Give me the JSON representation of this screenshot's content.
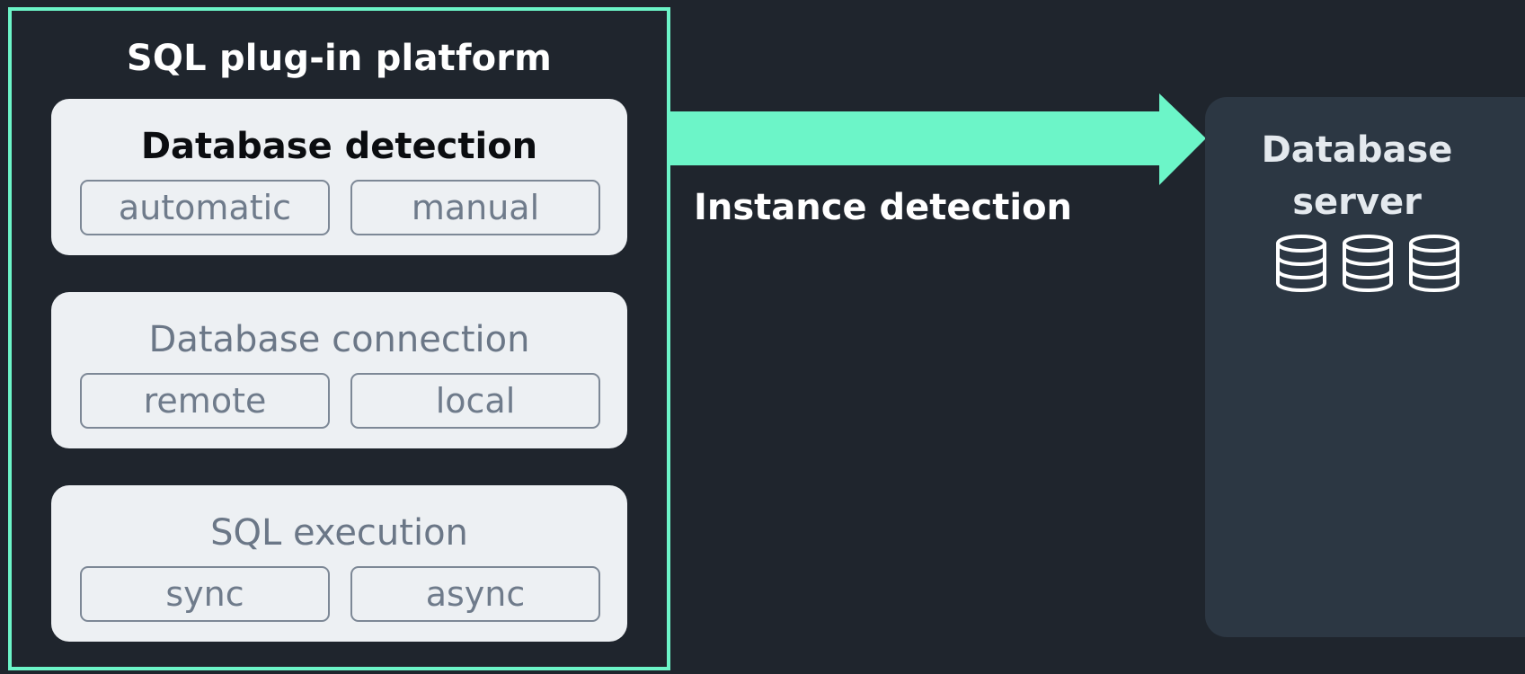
{
  "platform": {
    "title": "SQL plug-in platform",
    "sections": [
      {
        "title": "Database detection",
        "options": [
          "automatic",
          "manual"
        ],
        "active": true
      },
      {
        "title": "Database connection",
        "options": [
          "remote",
          "local"
        ],
        "active": false
      },
      {
        "title": "SQL execution",
        "options": [
          "sync",
          "async"
        ],
        "active": false
      }
    ]
  },
  "arrow": {
    "label": "Instance detection",
    "color": "#6cf5c8"
  },
  "server": {
    "title_line1": "Database",
    "title_line2": "server",
    "icons": [
      "database-icon",
      "database-icon",
      "database-icon"
    ]
  },
  "colors": {
    "background": "#1f252d",
    "accent": "#6cf5c8",
    "card": "#edf0f3",
    "server_panel": "#2c3743"
  }
}
